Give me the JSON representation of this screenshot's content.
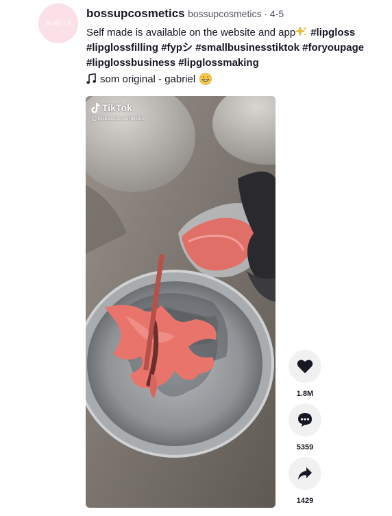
{
  "author": {
    "avatar_text": "BOSS UP",
    "username": "bossupcosmetics",
    "nickname_date": "bossupcosmetics · 4-5"
  },
  "caption": {
    "text": "Self made is available on the website and app",
    "sparkle_icon": "sparkles-icon",
    "hashtags": [
      "#lipgloss",
      "#lipglossfilling",
      "#fypシ",
      "#smallbusinesstiktok",
      "#foryoupage",
      "#lipglossbusiness",
      "#lipglossmaking"
    ]
  },
  "music": {
    "label": "som original - gabriel",
    "icon": "music-note-icon",
    "emoji": "grinning-face-icon"
  },
  "video": {
    "watermark_brand": "TikTok",
    "watermark_handle": "@bossupcosmetics"
  },
  "actions": {
    "likes": "1.8M",
    "comments": "5359",
    "shares": "1429"
  },
  "colors": {
    "avatar_bg": "#fbe0e8",
    "action_bg": "#f1f1f2",
    "text": "#161823"
  }
}
